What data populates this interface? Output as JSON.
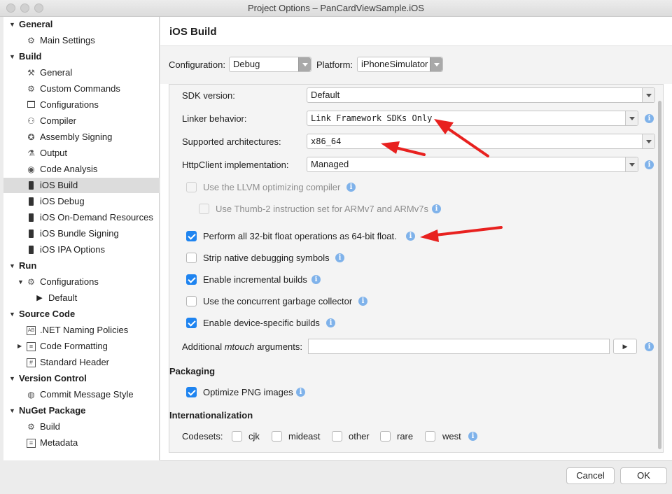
{
  "window": {
    "title": "Project Options – PanCardViewSample.iOS"
  },
  "sidebar": {
    "items": [
      {
        "label": "General",
        "type": "header"
      },
      {
        "label": "Main Settings",
        "icon": "gear-icon"
      },
      {
        "label": "Build",
        "type": "header"
      },
      {
        "label": "General",
        "icon": "hammer-icon"
      },
      {
        "label": "Custom Commands",
        "icon": "gear-icon"
      },
      {
        "label": "Configurations",
        "icon": "window-icon"
      },
      {
        "label": "Compiler",
        "icon": "compiler-icon"
      },
      {
        "label": "Assembly Signing",
        "icon": "badge-icon"
      },
      {
        "label": "Output",
        "icon": "flask-icon"
      },
      {
        "label": "Code Analysis",
        "icon": "target-icon"
      },
      {
        "label": "iOS Build",
        "icon": "phone-icon",
        "selected": true
      },
      {
        "label": "iOS Debug",
        "icon": "phone-icon"
      },
      {
        "label": "iOS On-Demand Resources",
        "icon": "phone-icon"
      },
      {
        "label": "iOS Bundle Signing",
        "icon": "phone-icon"
      },
      {
        "label": "iOS IPA Options",
        "icon": "phone-icon"
      },
      {
        "label": "Run",
        "type": "header"
      },
      {
        "label": "Configurations",
        "icon": "gear-icon"
      },
      {
        "label": "Default",
        "icon": "play-icon"
      },
      {
        "label": "Source Code",
        "type": "header"
      },
      {
        "label": ".NET Naming Policies",
        "icon": "naming-icon"
      },
      {
        "label": "Code Formatting",
        "icon": "format-icon"
      },
      {
        "label": "Standard Header",
        "icon": "hash-icon"
      },
      {
        "label": "Version Control",
        "type": "header"
      },
      {
        "label": "Commit Message Style",
        "icon": "commit-icon"
      },
      {
        "label": "NuGet Package",
        "type": "header"
      },
      {
        "label": "Build",
        "icon": "gear-icon"
      },
      {
        "label": "Metadata",
        "icon": "list-icon"
      }
    ]
  },
  "main": {
    "title": "iOS Build",
    "configuration_label": "Configuration:",
    "configuration_value": "Debug",
    "platform_label": "Platform:",
    "platform_value": "iPhoneSimulator",
    "sdk_version_label": "SDK version:",
    "sdk_version_value": "Default",
    "linker_label": "Linker behavior:",
    "linker_value": "Link Framework SDKs Only",
    "arch_label": "Supported architectures:",
    "arch_value": "x86_64",
    "httpclient_label": "HttpClient implementation:",
    "httpclient_value": "Managed",
    "llvm_label": "Use the LLVM optimizing compiler",
    "thumb_label": "Use Thumb-2 instruction set for ARMv7 and ARMv7s",
    "float_label": "Perform all 32-bit float operations as 64-bit float.",
    "strip_label": "Strip native debugging symbols",
    "incremental_label": "Enable incremental builds",
    "gc_label": "Use the concurrent garbage collector",
    "device_label": "Enable device-specific builds",
    "mtouch_label_pre": "Additional ",
    "mtouch_label_em": "mtouch",
    "mtouch_label_post": " arguments:",
    "mtouch_value": "",
    "packaging_title": "Packaging",
    "png_label": "Optimize PNG images",
    "intl_title": "Internationalization",
    "codesets_label": "Codesets:",
    "codesets": [
      "cjk",
      "mideast",
      "other",
      "rare",
      "west"
    ]
  },
  "checkbox_states": {
    "llvm": false,
    "thumb": false,
    "float": true,
    "strip": false,
    "incremental": true,
    "gc": false,
    "device": true,
    "png": true
  },
  "footer": {
    "cancel_label": "Cancel",
    "ok_label": "OK"
  },
  "colors": {
    "accent": "#1f84f0",
    "annotation_arrow": "#e8211f",
    "info_icon": "#7fb2ea"
  }
}
